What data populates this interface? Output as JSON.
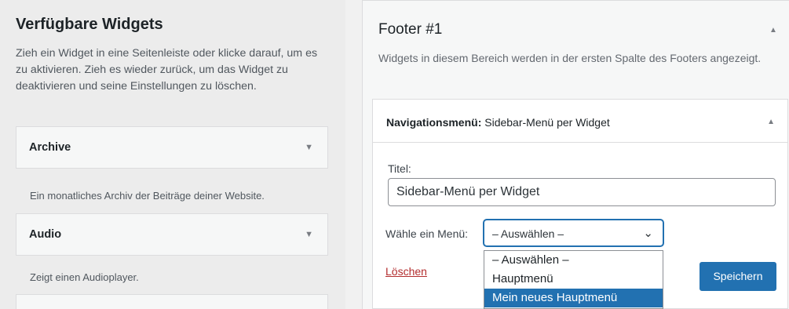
{
  "available": {
    "title": "Verfügbare Widgets",
    "description": "Zieh ein Widget in eine Seitenleiste oder klicke darauf, um es zu aktivieren. Zieh es wieder zurück, um das Widget zu deaktivieren und seine Einstellungen zu löschen.",
    "widgets": [
      {
        "label": "Archive",
        "desc": "Ein monatliches Archiv der Beiträge deiner Website."
      },
      {
        "label": "Audio",
        "desc": "Zeigt einen Audioplayer."
      }
    ]
  },
  "sidebar": {
    "title": "Footer #1",
    "description": "Widgets in diesem Bereich werden in der ersten Spalte des Footers angezeigt."
  },
  "widget_panel": {
    "title_prefix": "Navigationsmenü:",
    "title_name": "Sidebar-Menü per Widget",
    "title_label": "Titel:",
    "title_value": "Sidebar-Menü per Widget",
    "menu_label": "Wähle ein Menü:",
    "menu_selected": "– Auswählen –",
    "menu_options": [
      "– Auswählen –",
      "Hauptmenü",
      "Mein neues Hauptmenü"
    ],
    "highlighted_option": "Mein neues Hauptmenü",
    "delete_label": "Löschen",
    "save_label": "Speichern"
  },
  "icons": {
    "collapse": "triangle-down-icon",
    "expand": "triangle-up-icon",
    "select_chevron": "chevron-down-icon"
  },
  "colors": {
    "accent": "#2271b1",
    "delete": "#b32d2e"
  }
}
